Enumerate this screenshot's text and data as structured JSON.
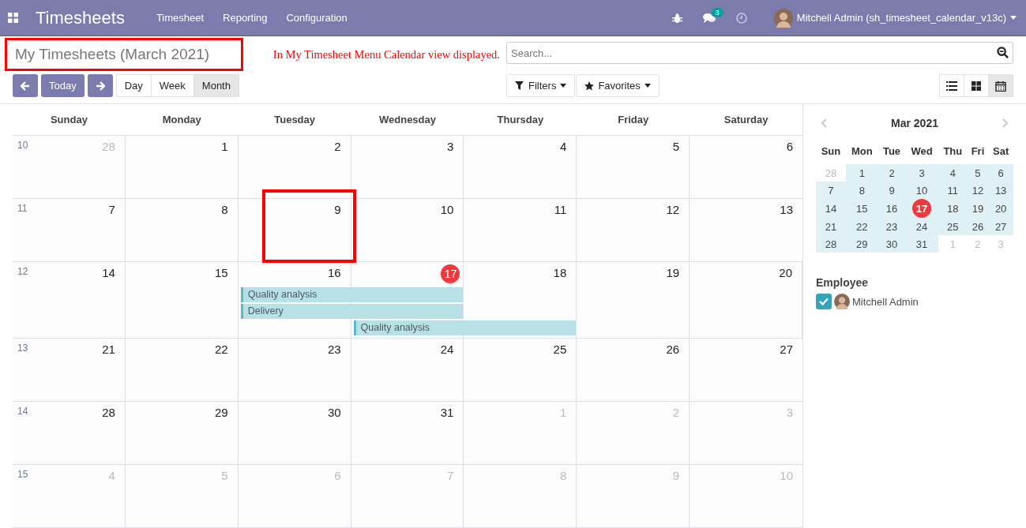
{
  "navbar": {
    "app_title": "Timesheets",
    "menus": [
      "Timesheet",
      "Reporting",
      "Configuration"
    ],
    "message_count": "3",
    "user_name": "Mitchell Admin (sh_timesheet_calendar_v13c)"
  },
  "control_panel": {
    "title": "My Timesheets (March 2021)",
    "title_highlighted": true,
    "annotation": "In My Timesheet Menu Calendar view displayed.",
    "search_placeholder": "Search...",
    "today_label": "Today",
    "scales": [
      {
        "label": "Day",
        "selected": false
      },
      {
        "label": "Week",
        "selected": false
      },
      {
        "label": "Month",
        "selected": true
      }
    ],
    "filters": [
      "Filters",
      "Favorites"
    ],
    "views": [
      {
        "kind": "list",
        "selected": false
      },
      {
        "kind": "kanban",
        "selected": false
      },
      {
        "kind": "calendar",
        "selected": true
      }
    ]
  },
  "calendar": {
    "weekdays": [
      "Sunday",
      "Monday",
      "Tuesday",
      "Wednesday",
      "Thursday",
      "Friday",
      "Saturday"
    ],
    "weeks": [
      {
        "number": "10",
        "days": [
          {
            "day": "28",
            "other_month": true,
            "today": false,
            "highlighted": false
          },
          {
            "day": "1",
            "other_month": false,
            "today": false,
            "highlighted": false
          },
          {
            "day": "2",
            "other_month": false,
            "today": false,
            "highlighted": false
          },
          {
            "day": "3",
            "other_month": false,
            "today": false,
            "highlighted": false
          },
          {
            "day": "4",
            "other_month": false,
            "today": false,
            "highlighted": false
          },
          {
            "day": "5",
            "other_month": false,
            "today": false,
            "highlighted": false
          },
          {
            "day": "6",
            "other_month": false,
            "today": false,
            "highlighted": false
          }
        ]
      },
      {
        "number": "11",
        "days": [
          {
            "day": "7",
            "other_month": false,
            "today": false,
            "highlighted": false
          },
          {
            "day": "8",
            "other_month": false,
            "today": false,
            "highlighted": false
          },
          {
            "day": "9",
            "other_month": false,
            "today": false,
            "highlighted": true
          },
          {
            "day": "10",
            "other_month": false,
            "today": false,
            "highlighted": false
          },
          {
            "day": "11",
            "other_month": false,
            "today": false,
            "highlighted": false
          },
          {
            "day": "12",
            "other_month": false,
            "today": false,
            "highlighted": false
          },
          {
            "day": "13",
            "other_month": false,
            "today": false,
            "highlighted": false
          }
        ]
      },
      {
        "number": "12",
        "days": [
          {
            "day": "14",
            "other_month": false,
            "today": false,
            "highlighted": false
          },
          {
            "day": "15",
            "other_month": false,
            "today": false,
            "highlighted": false
          },
          {
            "day": "16",
            "other_month": false,
            "today": false,
            "highlighted": false,
            "events": [
              {
                "label": "Quality analysis",
                "multi_day": true
              },
              {
                "label": "Delivery",
                "multi_day": true
              }
            ]
          },
          {
            "day": "17",
            "other_month": false,
            "today": true,
            "highlighted": false,
            "events": [
              {
                "label": "Quality analysis",
                "multi_day": true
              }
            ]
          },
          {
            "day": "18",
            "other_month": false,
            "today": false,
            "highlighted": false
          },
          {
            "day": "19",
            "other_month": false,
            "today": false,
            "highlighted": false
          },
          {
            "day": "20",
            "other_month": false,
            "today": false,
            "highlighted": false
          }
        ]
      },
      {
        "number": "13",
        "days": [
          {
            "day": "21",
            "other_month": false,
            "today": false,
            "highlighted": false
          },
          {
            "day": "22",
            "other_month": false,
            "today": false,
            "highlighted": false
          },
          {
            "day": "23",
            "other_month": false,
            "today": false,
            "highlighted": false
          },
          {
            "day": "24",
            "other_month": false,
            "today": false,
            "highlighted": false
          },
          {
            "day": "25",
            "other_month": false,
            "today": false,
            "highlighted": false
          },
          {
            "day": "26",
            "other_month": false,
            "today": false,
            "highlighted": false
          },
          {
            "day": "27",
            "other_month": false,
            "today": false,
            "highlighted": false
          }
        ]
      },
      {
        "number": "14",
        "days": [
          {
            "day": "28",
            "other_month": false,
            "today": false,
            "highlighted": false
          },
          {
            "day": "29",
            "other_month": false,
            "today": false,
            "highlighted": false
          },
          {
            "day": "30",
            "other_month": false,
            "today": false,
            "highlighted": false
          },
          {
            "day": "31",
            "other_month": false,
            "today": false,
            "highlighted": false
          },
          {
            "day": "1",
            "other_month": true,
            "today": false,
            "highlighted": false
          },
          {
            "day": "2",
            "other_month": true,
            "today": false,
            "highlighted": false
          },
          {
            "day": "3",
            "other_month": true,
            "today": false,
            "highlighted": false
          }
        ]
      },
      {
        "number": "15",
        "days": [
          {
            "day": "4",
            "other_month": true,
            "today": false,
            "highlighted": false
          },
          {
            "day": "5",
            "other_month": true,
            "today": false,
            "highlighted": false
          },
          {
            "day": "6",
            "other_month": true,
            "today": false,
            "highlighted": false
          },
          {
            "day": "7",
            "other_month": true,
            "today": false,
            "highlighted": false
          },
          {
            "day": "8",
            "other_month": true,
            "today": false,
            "highlighted": false
          },
          {
            "day": "9",
            "other_month": true,
            "today": false,
            "highlighted": false
          },
          {
            "day": "10",
            "other_month": true,
            "today": false,
            "highlighted": false
          }
        ]
      }
    ]
  },
  "sidebar": {
    "mini_calendar": {
      "title": "Mar 2021",
      "weekdays": [
        "Sun",
        "Mon",
        "Tue",
        "Wed",
        "Thu",
        "Fri",
        "Sat"
      ],
      "weeks": [
        [
          {
            "day": "28",
            "in_month": false,
            "today": false
          },
          {
            "day": "1",
            "in_month": true,
            "today": false
          },
          {
            "day": "2",
            "in_month": true,
            "today": false
          },
          {
            "day": "3",
            "in_month": true,
            "today": false
          },
          {
            "day": "4",
            "in_month": true,
            "today": false
          },
          {
            "day": "5",
            "in_month": true,
            "today": false
          },
          {
            "day": "6",
            "in_month": true,
            "today": false
          }
        ],
        [
          {
            "day": "7",
            "in_month": true,
            "today": false
          },
          {
            "day": "8",
            "in_month": true,
            "today": false
          },
          {
            "day": "9",
            "in_month": true,
            "today": false
          },
          {
            "day": "10",
            "in_month": true,
            "today": false
          },
          {
            "day": "11",
            "in_month": true,
            "today": false
          },
          {
            "day": "12",
            "in_month": true,
            "today": false
          },
          {
            "day": "13",
            "in_month": true,
            "today": false
          }
        ],
        [
          {
            "day": "14",
            "in_month": true,
            "today": false
          },
          {
            "day": "15",
            "in_month": true,
            "today": false
          },
          {
            "day": "16",
            "in_month": true,
            "today": false
          },
          {
            "day": "17",
            "in_month": true,
            "today": true
          },
          {
            "day": "18",
            "in_month": true,
            "today": false
          },
          {
            "day": "19",
            "in_month": true,
            "today": false
          },
          {
            "day": "20",
            "in_month": true,
            "today": false
          }
        ],
        [
          {
            "day": "21",
            "in_month": true,
            "today": false
          },
          {
            "day": "22",
            "in_month": true,
            "today": false
          },
          {
            "day": "23",
            "in_month": true,
            "today": false
          },
          {
            "day": "24",
            "in_month": true,
            "today": false
          },
          {
            "day": "25",
            "in_month": true,
            "today": false
          },
          {
            "day": "26",
            "in_month": true,
            "today": false
          },
          {
            "day": "27",
            "in_month": true,
            "today": false
          }
        ],
        [
          {
            "day": "28",
            "in_month": true,
            "today": false
          },
          {
            "day": "29",
            "in_month": true,
            "today": false
          },
          {
            "day": "30",
            "in_month": true,
            "today": false
          },
          {
            "day": "31",
            "in_month": true,
            "today": false
          },
          {
            "day": "1",
            "in_month": false,
            "today": false
          },
          {
            "day": "2",
            "in_month": false,
            "today": false
          },
          {
            "day": "3",
            "in_month": false,
            "today": false
          }
        ]
      ]
    },
    "filter_title": "Employee",
    "employees": [
      {
        "name": "Mitchell Admin",
        "checked": true
      }
    ]
  }
}
